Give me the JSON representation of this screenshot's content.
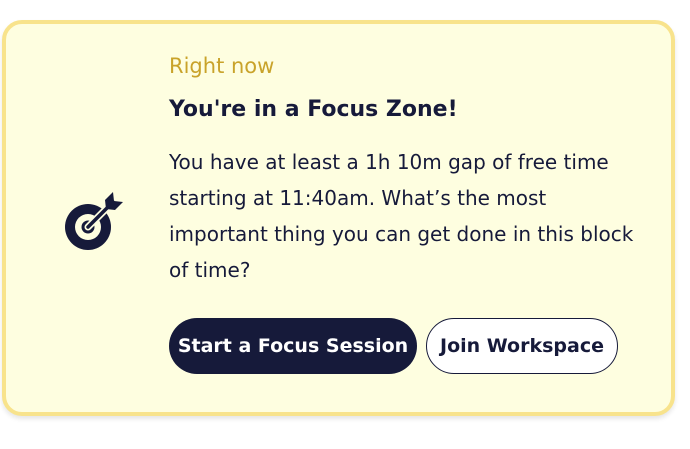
{
  "card": {
    "eyebrow": "Right now",
    "title": "You're in a Focus Zone!",
    "description": "You have at least a 1h 10m gap of free time starting at 11:40am. What’s the most important thing you can get done in this block of time?",
    "icon": "target-arrow-icon"
  },
  "actions": {
    "primary_label": "Start a Focus Session",
    "secondary_label": "Join Workspace"
  },
  "colors": {
    "card_background": "#fefee0",
    "card_border": "#f8e38c",
    "accent": "#c9a32a",
    "navy": "#161a3a"
  }
}
